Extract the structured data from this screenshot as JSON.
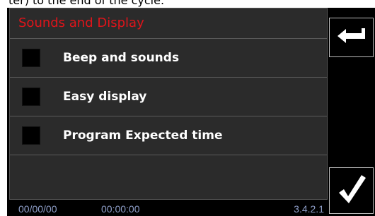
{
  "top_caption": "ter) to the end of the cycle.",
  "panel": {
    "title": "Sounds and Display",
    "title_color": "#e0141a",
    "options": [
      {
        "label": "Beep and sounds",
        "checked": false
      },
      {
        "label": "Easy display",
        "checked": false
      },
      {
        "label": "Program Expected time",
        "checked": false
      }
    ]
  },
  "status_bar": {
    "date": "00/00/00",
    "time": "00:00:00",
    "version": "3.4.2.1"
  },
  "buttons": {
    "back_icon": "return-arrow-icon",
    "confirm_icon": "check-icon"
  }
}
